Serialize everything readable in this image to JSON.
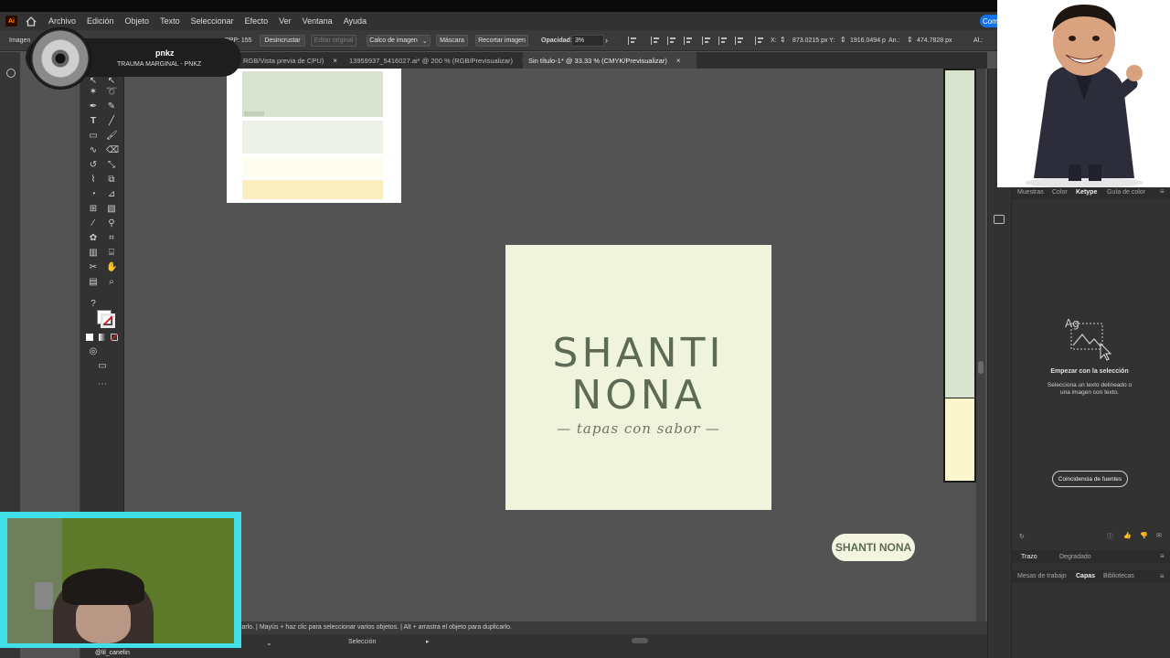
{
  "menubar": {
    "app_logo": "Ai",
    "items": [
      "Archivo",
      "Edición",
      "Objeto",
      "Texto",
      "Seleccionar",
      "Efecto",
      "Ver",
      "Ventana",
      "Ayuda"
    ],
    "share": "Com"
  },
  "control": {
    "imagen": "Imagen",
    "ppp": "PPP: 155",
    "desincrustar": "Desincrustar",
    "editar_original": "Editar original",
    "calco": "Calco de imagen",
    "mascara": "Máscara",
    "recortar": "Recortar imagen",
    "opacidad_label": "Opacidad:",
    "opacidad_value": "3%",
    "x_label": "X:",
    "x_value": "873.0215 px",
    "y_label": "Y:",
    "y_value": "1916.0494 p",
    "w_label": "An.:",
    "w_value": "474.7828 px",
    "h_label": "Al.:"
  },
  "tabs": [
    {
      "label": "RGB/Vista previa de CPU)",
      "active": false
    },
    {
      "label": "13959937_5416027.ai* @ 200 % (RGB/Previsualizar)",
      "active": false
    },
    {
      "label": "Sin título-1* @ 33.33 % (CMYK/Previsualizar)",
      "active": true
    }
  ],
  "tab_close": "×",
  "logo": {
    "line1": "SHANTI",
    "line2": "NONA",
    "tagline": "— tapas con sabor —"
  },
  "pill": "SHANTI NONA",
  "status": {
    "hint": "clic/arrastrar. | Mayús + haz clic para seleccionar varios objetos. | Alt + arrastra el objeto para duplicarlo.",
    "hint_visible": "carlo. | Mayús + haz clic para seleccionar varios objetos. | Alt + arrastra el objeto para duplicarlo.",
    "tool": "Selección"
  },
  "right_panel": {
    "tabs": [
      "Muestras",
      "Color",
      "Ketype",
      "Guía de color"
    ],
    "active_tab": "Ketype",
    "heading": "Empezar con la selección",
    "desc": "Selecciona un texto delineado o una imagen con texto.",
    "button": "Coincidencia de fuentes",
    "illus_text": "Ag",
    "lower_tabs": [
      "Trazo",
      "Degradado"
    ],
    "bottom_tabs": [
      "Mesas de trabajo",
      "Capas",
      "Bibliotecas"
    ],
    "active_bottom": "Capas"
  },
  "overlay": {
    "profile_name": "pnkz",
    "profile_song": "TRAUMA MARGINAL - PNKZ",
    "webcam_user": "@lil_canelin"
  },
  "colors": {
    "accent": "#1473e6",
    "logo_text": "#5d6a55",
    "artboard_bg": "#f1f4dc",
    "guide": "#c42424",
    "webcam_frame": "#3fe0e8"
  }
}
